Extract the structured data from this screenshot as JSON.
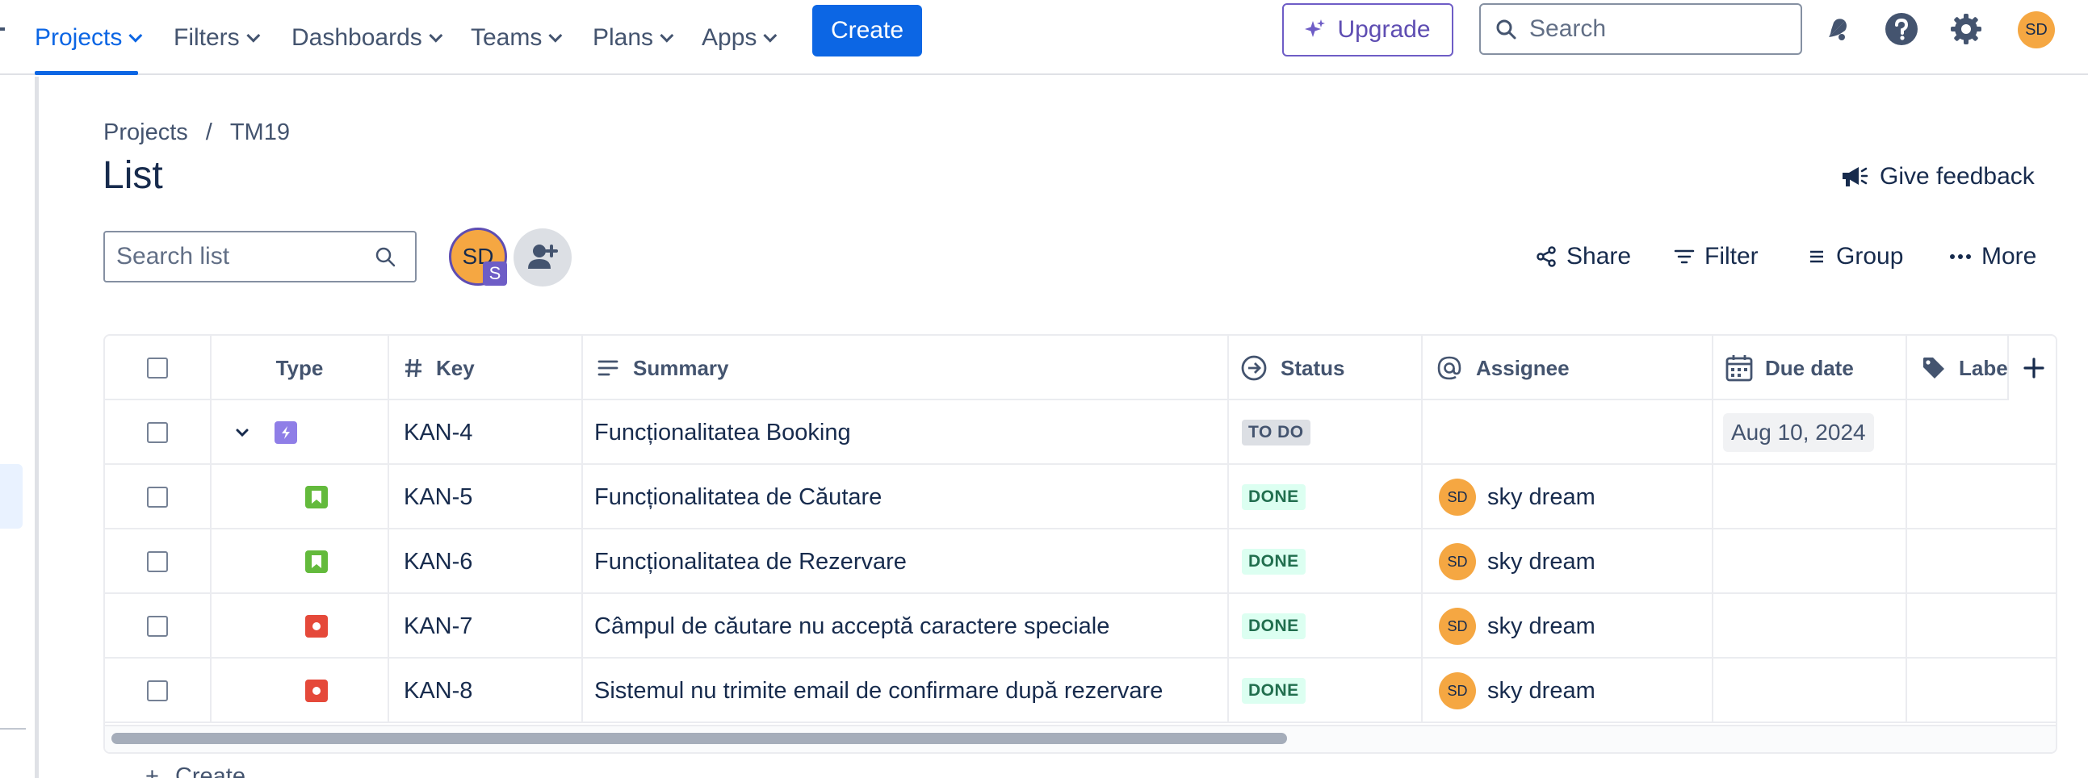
{
  "nav": {
    "items": [
      {
        "label": "Projects",
        "active": true
      },
      {
        "label": "Filters"
      },
      {
        "label": "Dashboards"
      },
      {
        "label": "Teams"
      },
      {
        "label": "Plans"
      },
      {
        "label": "Apps"
      }
    ],
    "create_label": "Create",
    "upgrade_label": "Upgrade",
    "search_placeholder": "Search",
    "avatar_initials": "SD",
    "icons": [
      "notifications-icon",
      "help-icon",
      "settings-icon"
    ]
  },
  "breadcrumb": {
    "root": "Projects",
    "separator": "/",
    "current": "TM19"
  },
  "page": {
    "title": "List",
    "feedback_label": "Give feedback",
    "search_placeholder": "Search list",
    "avatar_initials": "SD",
    "avatar_badge": "S"
  },
  "toolbar": {
    "share": "Share",
    "filter": "Filter",
    "group": "Group",
    "more": "More"
  },
  "table": {
    "columns": {
      "type": "Type",
      "key": "Key",
      "summary": "Summary",
      "status": "Status",
      "assignee": "Assignee",
      "due_date": "Due date",
      "labels": "Labe"
    },
    "rows": [
      {
        "type": "epic",
        "key": "KAN-4",
        "summary": "Funcționalitatea Booking",
        "status": "TO DO",
        "assignee": "",
        "assignee_initials": "",
        "due_date": "Aug 10, 2024",
        "expanded": true
      },
      {
        "type": "story",
        "key": "KAN-5",
        "summary": "Funcționalitatea de Căutare",
        "status": "DONE",
        "assignee": "sky dream",
        "assignee_initials": "SD",
        "due_date": ""
      },
      {
        "type": "story",
        "key": "KAN-6",
        "summary": "Funcționalitatea de Rezervare",
        "status": "DONE",
        "assignee": "sky dream",
        "assignee_initials": "SD",
        "due_date": ""
      },
      {
        "type": "bug",
        "key": "KAN-7",
        "summary": "Câmpul de căutare nu acceptă caractere speciale",
        "status": "DONE",
        "assignee": "sky dream",
        "assignee_initials": "SD",
        "due_date": ""
      },
      {
        "type": "bug",
        "key": "KAN-8",
        "summary": "Sistemul nu trimite email de confirmare după rezervare",
        "status": "DONE",
        "assignee": "sky dream",
        "assignee_initials": "SD",
        "due_date": ""
      }
    ],
    "create_label": "Create"
  },
  "colors": {
    "accent": "#0c66e4",
    "epic": "#8f7ee7",
    "story": "#63ba3c",
    "bug": "#e5493a",
    "done_bg": "#dcfff1",
    "done_text": "#216e4e",
    "todo_bg": "#dcdfe4",
    "todo_text": "#44546f"
  }
}
